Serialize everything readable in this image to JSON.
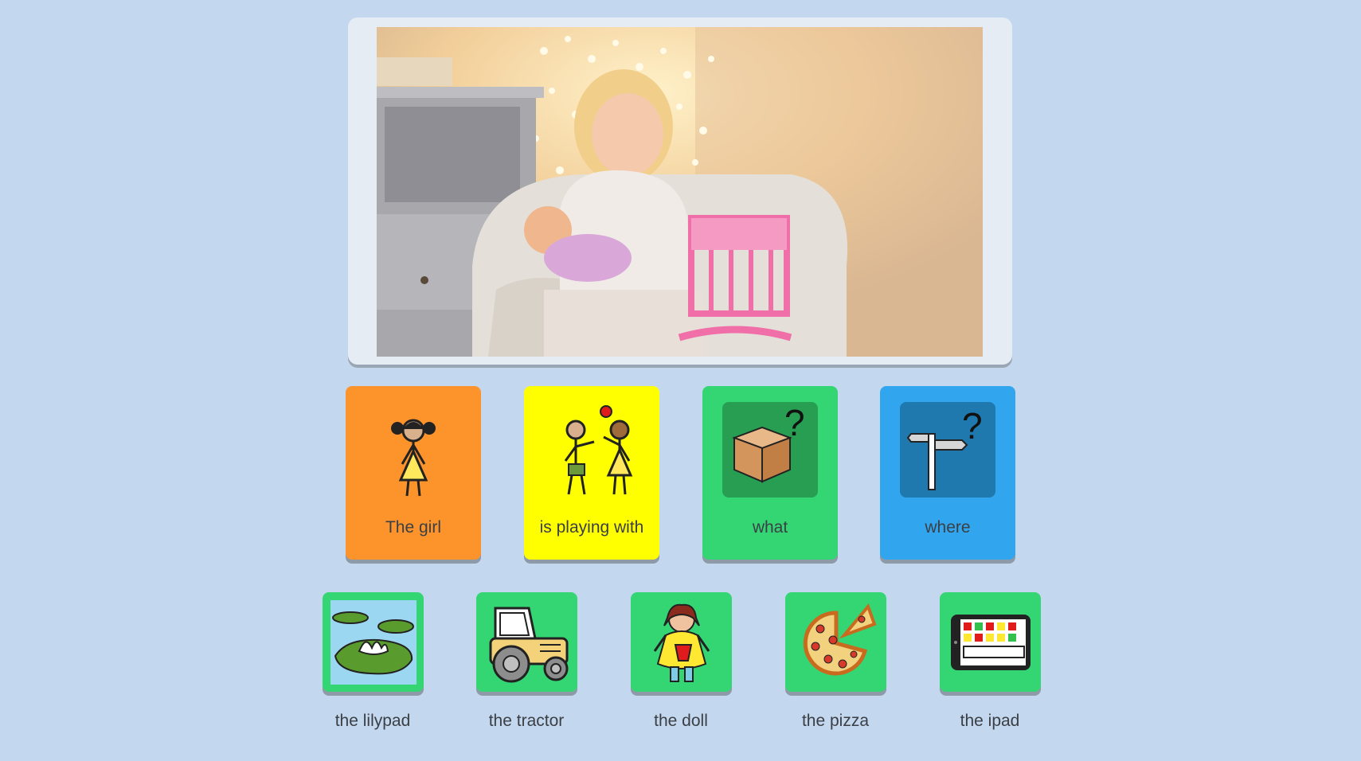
{
  "colors": {
    "background": "#c3d7ee",
    "subject_card": "#fd942b",
    "verb_card": "#ffff00",
    "question_card_what": "#34d674",
    "question_card_where": "#31a6ee",
    "object_card": "#34d674",
    "label_text": "#3b3f45"
  },
  "scene_photo": {
    "icon": "photo-girl-playing-with-doll"
  },
  "sentence_cards": [
    {
      "label": "The girl",
      "icon": "girl-icon"
    },
    {
      "label": "is playing with",
      "icon": "children-playing-ball-icon"
    },
    {
      "label": "what",
      "icon": "box-question-icon"
    },
    {
      "label": "where",
      "icon": "signpost-question-icon"
    }
  ],
  "object_cards": [
    {
      "label": "the lilypad",
      "icon": "lilypad-icon"
    },
    {
      "label": "the tractor",
      "icon": "tractor-icon"
    },
    {
      "label": "the doll",
      "icon": "doll-icon"
    },
    {
      "label": "the pizza",
      "icon": "pizza-icon"
    },
    {
      "label": "the ipad",
      "icon": "ipad-icon"
    }
  ]
}
